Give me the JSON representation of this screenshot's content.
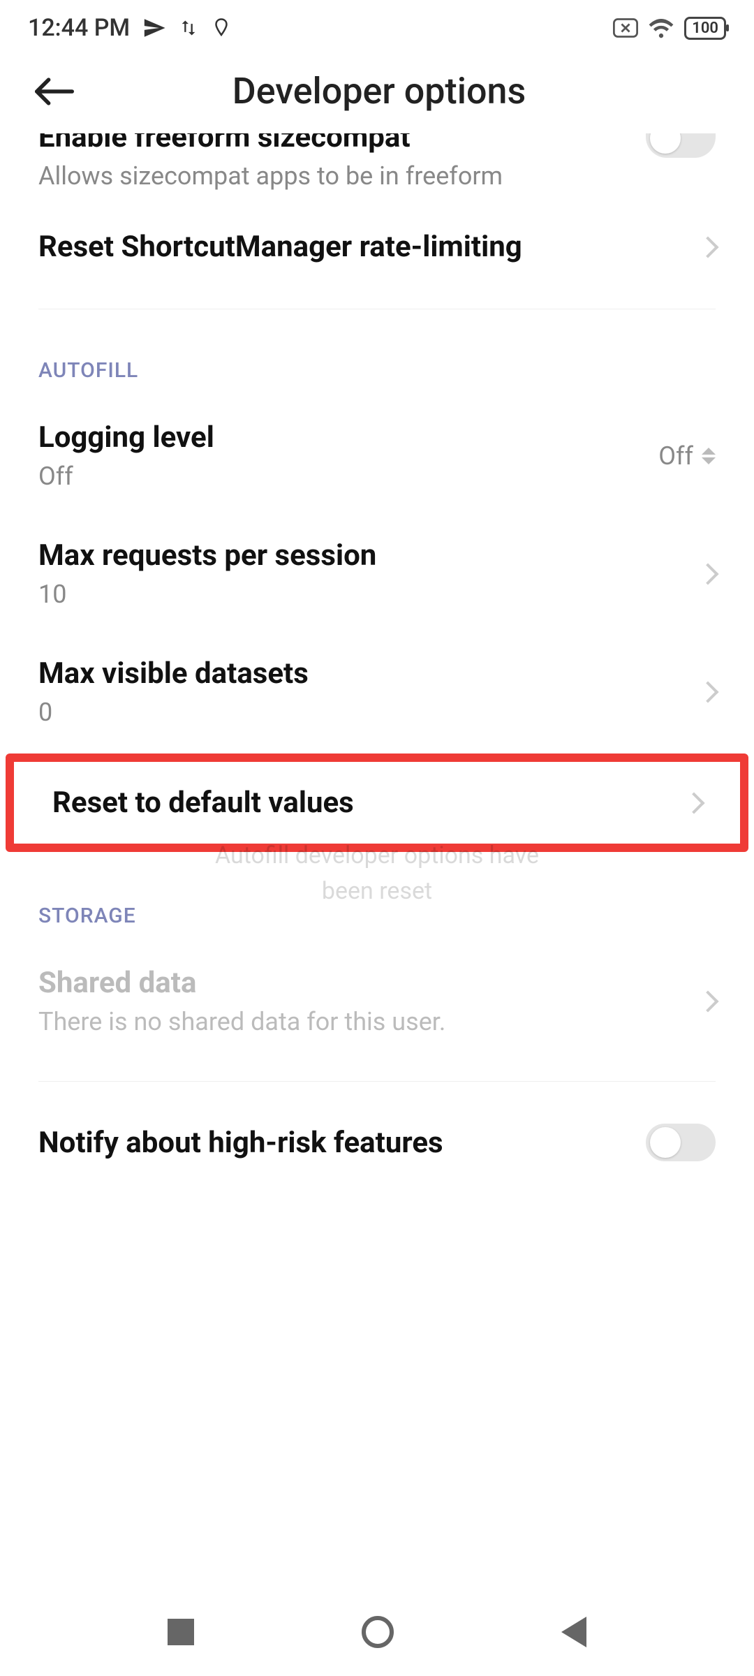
{
  "status": {
    "time": "12:44 PM",
    "battery": "100"
  },
  "header": {
    "title": "Developer options"
  },
  "rows": {
    "freeform": {
      "title": "Enable freeform sizecompat",
      "sub": "Allows sizecompat apps to be in freeform"
    },
    "reset_shortcut": {
      "title": "Reset ShortcutManager rate-limiting"
    },
    "logging": {
      "title": "Logging level",
      "sub": "Off",
      "value": "Off"
    },
    "max_requests": {
      "title": "Max requests per session",
      "sub": "10"
    },
    "max_visible": {
      "title": "Max visible datasets",
      "sub": "0"
    },
    "reset_defaults": {
      "title": "Reset to default values"
    },
    "shared_data": {
      "title": "Shared data",
      "sub": "There is no shared data for this user."
    },
    "notify_risk": {
      "title": "Notify about high-risk features"
    }
  },
  "sections": {
    "autofill": "AUTOFILL",
    "storage": "STORAGE"
  },
  "toast": "Autofill developer options have\nbeen reset"
}
